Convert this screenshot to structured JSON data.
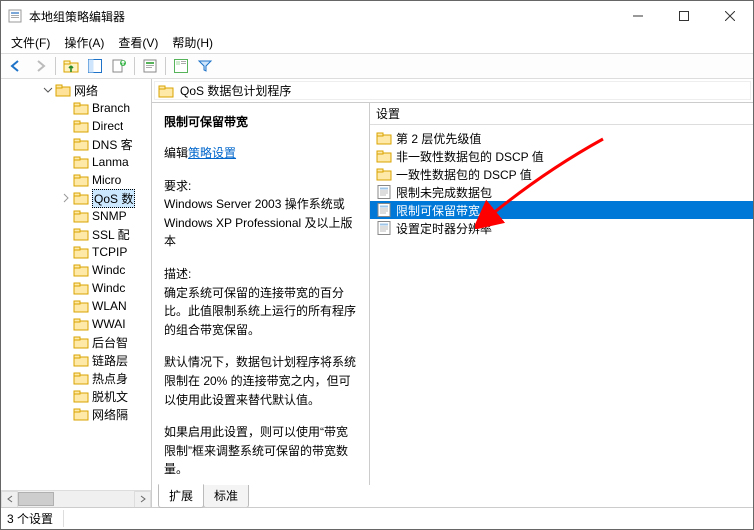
{
  "window": {
    "title": "本地组策略编辑器"
  },
  "menus": {
    "file": "文件(F)",
    "action": "操作(A)",
    "view": "查看(V)",
    "help": "帮助(H)"
  },
  "tree": {
    "root": "网络",
    "items": [
      "Branch",
      "Direct",
      "DNS 客",
      "Lanma",
      "Micro",
      "QoS 数",
      "SNMP",
      "SSL 配",
      "TCPIP",
      "Windc",
      "Windc",
      "WLAN",
      "WWAI",
      "后台智",
      "链路层",
      "热点身",
      "脱机文",
      "网络隔"
    ],
    "selected_index": 5
  },
  "path": {
    "label": "QoS 数据包计划程序"
  },
  "description": {
    "title": "限制可保留带宽",
    "edit_prefix": "编辑",
    "edit_link": "策略设置",
    "req_h": "要求:",
    "req_body": "Windows Server 2003 操作系统或 Windows XP Professional 及以上版本",
    "desc_h": "描述:",
    "desc_1": "确定系统可保留的连接带宽的百分比。此值限制系统上运行的所有程序的组合带宽保留。",
    "desc_2": "默认情况下，数据包计划程序将系统限制在 20% 的连接带宽之内，但可以使用此设置来替代默认值。",
    "desc_3": "如果启用此设置，则可以使用“带宽限制”框来调整系统可保留的带宽数量。"
  },
  "list": {
    "header": "设置",
    "items": [
      {
        "type": "folder",
        "label": "第 2 层优先级值"
      },
      {
        "type": "folder",
        "label": "非一致性数据包的 DSCP 值"
      },
      {
        "type": "folder",
        "label": "一致性数据包的 DSCP 值"
      },
      {
        "type": "setting",
        "label": "限制未完成数据包"
      },
      {
        "type": "setting",
        "label": "限制可保留带宽"
      },
      {
        "type": "setting",
        "label": "设置定时器分辨率"
      }
    ],
    "selected_index": 4
  },
  "tabs": {
    "extended": "扩展",
    "standard": "标准"
  },
  "status": {
    "count": "3 个设置"
  }
}
